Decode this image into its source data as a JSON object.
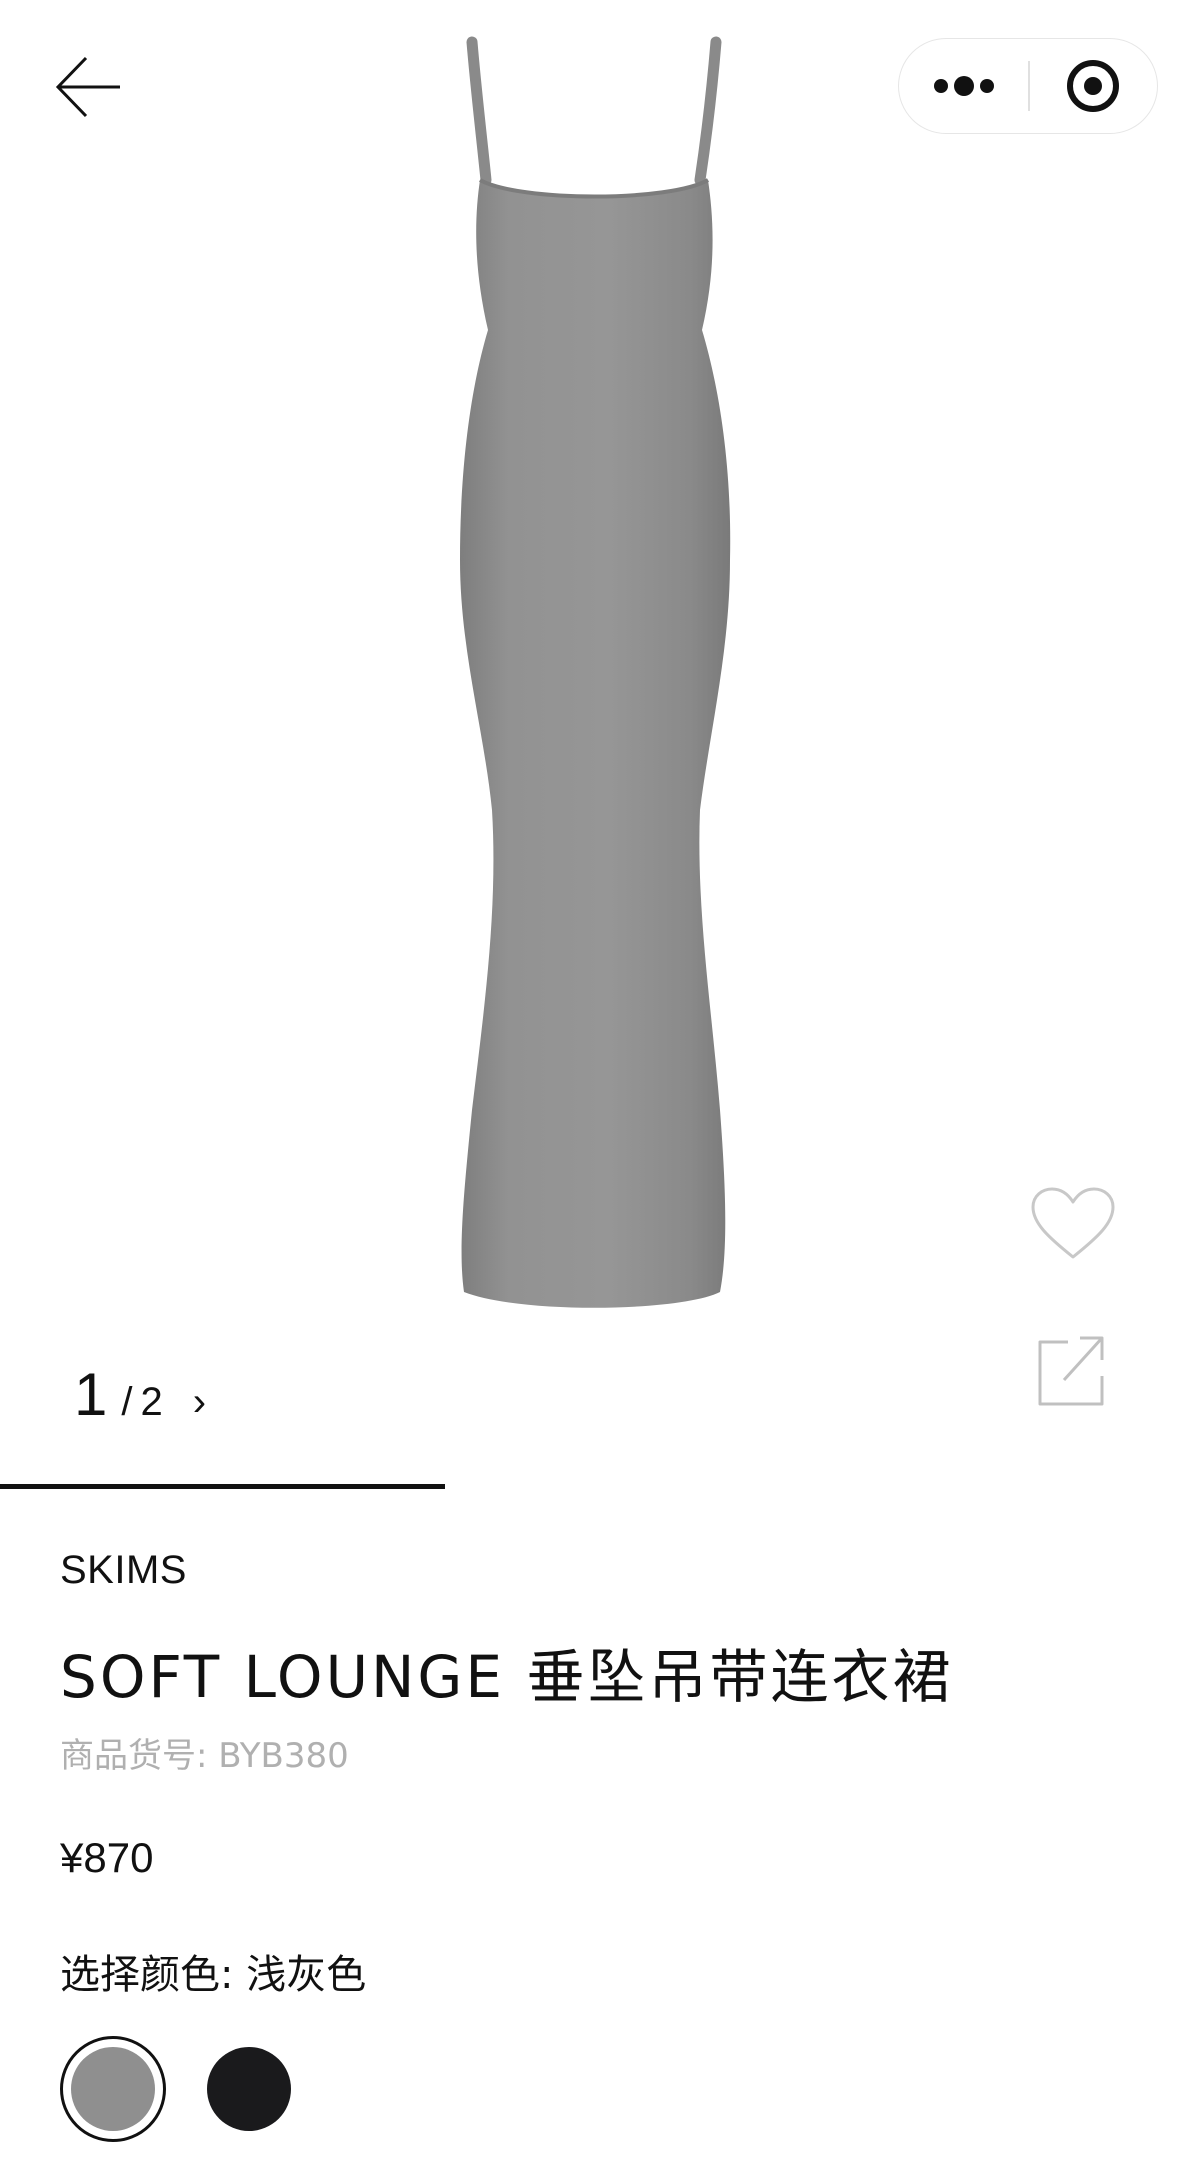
{
  "pager": {
    "current": "1",
    "separator": "/",
    "total": "2",
    "next": "›",
    "progress": 0.5
  },
  "product": {
    "brand": "SKIMS",
    "title": "SOFT LOUNGE 垂坠吊带连衣裙",
    "sku_label": "商品货号:",
    "sku": "BYB380",
    "price": "¥870",
    "color_label": "选择颜色:",
    "color_value": "浅灰色",
    "image_color": "#8e8e8e"
  },
  "swatches": [
    {
      "color": "#8f8f8f",
      "selected": true
    },
    {
      "color": "#1a1a1c",
      "selected": false
    }
  ],
  "icons": {
    "back": "arrow-left-icon",
    "more": "more-dots-icon",
    "close": "target-close-icon",
    "favorite": "heart-outline-icon",
    "share": "share-external-icon"
  }
}
